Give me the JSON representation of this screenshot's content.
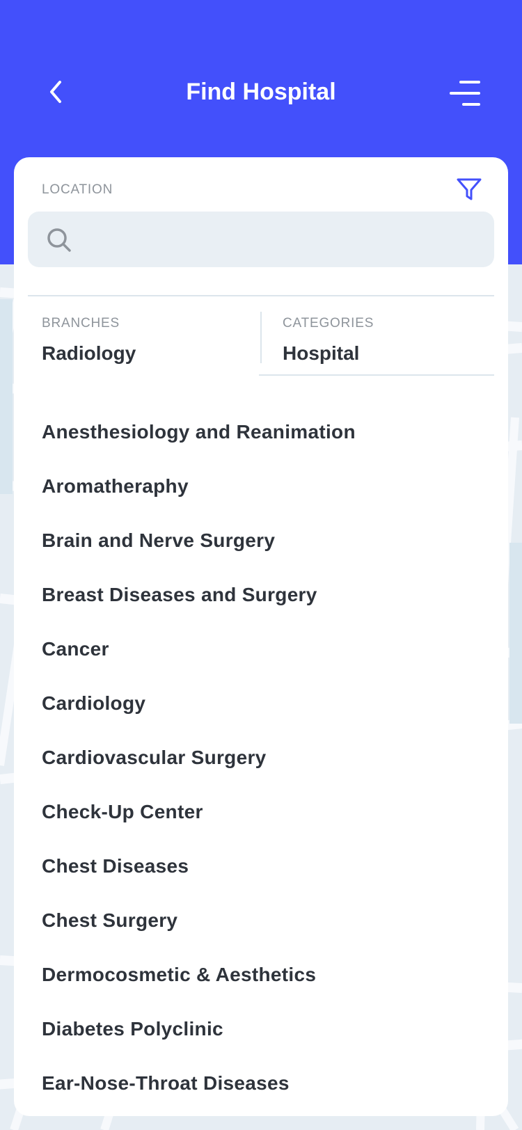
{
  "header": {
    "title": "Find Hospital",
    "background_color": "#4350fb"
  },
  "icons": {
    "back": "chevron-left-icon",
    "menu": "menu-lines-icon",
    "filter": "filter-icon",
    "search": "search-icon"
  },
  "location": {
    "label": "LOCATION",
    "value": "",
    "placeholder": ""
  },
  "branches": {
    "label": "BRANCHES",
    "value": "Radiology"
  },
  "categories": {
    "label": "CATEGORIES",
    "value": "Hospital"
  },
  "branch_list": [
    "Anesthesiology and Reanimation",
    "Aromatheraphy",
    "Brain and Nerve Surgery",
    "Breast Diseases and Surgery",
    "Cancer",
    "Cardiology",
    "Cardiovascular Surgery",
    "Check-Up Center",
    "Chest Diseases",
    "Chest Surgery",
    "Dermocosmetic & Aesthetics",
    "Diabetes Polyclinic",
    "Ear-Nose-Throat Diseases"
  ],
  "colors": {
    "accent": "#4350fb",
    "text_primary": "#2e333b",
    "text_secondary": "#8e949b",
    "input_background": "#e9eff4",
    "map_background": "#e6edf3"
  }
}
